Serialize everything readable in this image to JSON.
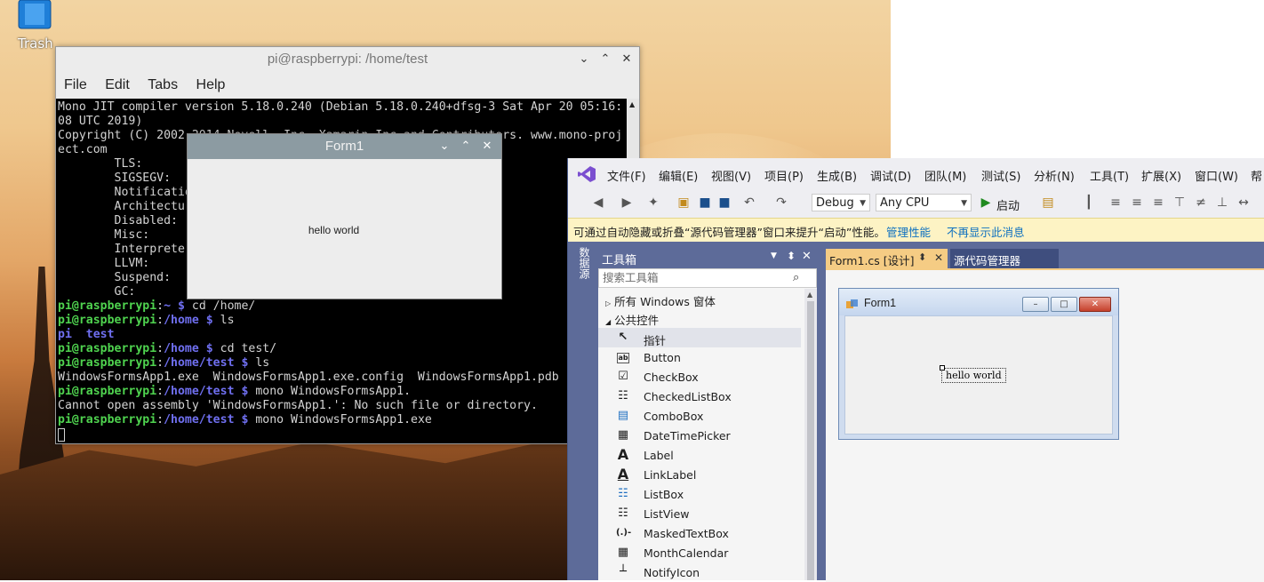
{
  "desktop": {
    "trash_label": "Trash",
    "icons": [
      "trash-icon"
    ]
  },
  "terminal": {
    "title": "pi@raspberrypi: /home/test",
    "menu": [
      "File",
      "Edit",
      "Tabs",
      "Help"
    ],
    "lines": [
      "Mono JIT compiler version 5.18.0.240 (Debian 5.18.0.240+dfsg-3 Sat Apr 20 05:16:",
      "08 UTC 2019)",
      "Copyright (C) 2002-2014 Novell, Inc, Xamarin Inc and Contributors. www.mono-proj",
      "ect.com",
      "        TLS:",
      "        SIGSEGV:",
      "        Notificatio",
      "        Architectur",
      "        Disabled:",
      "        Misc:",
      "        Interprete",
      "        LLVM:",
      "        Suspend:",
      "        GC:"
    ],
    "prompts": [
      {
        "user": "pi@raspberrypi",
        "path": "~",
        "cmd": "cd /home/"
      },
      {
        "user": "pi@raspberrypi",
        "path": "/home",
        "cmd": "ls"
      },
      {
        "output_blue": "pi  test"
      },
      {
        "user": "pi@raspberrypi",
        "path": "/home",
        "cmd": "cd test/"
      },
      {
        "user": "pi@raspberrypi",
        "path": "/home/test",
        "cmd": "ls"
      },
      {
        "output": "WindowsFormsApp1.exe  WindowsFormsApp1.exe.config  WindowsFormsApp1.pdb"
      },
      {
        "user": "pi@raspberrypi",
        "path": "/home/test",
        "cmd": "mono WindowsFormsApp1."
      },
      {
        "output": "Cannot open assembly 'WindowsFormsApp1.': No such file or directory."
      },
      {
        "user": "pi@raspberrypi",
        "path": "/home/test",
        "cmd": "mono WindowsFormsApp1.exe"
      }
    ],
    "colors": {
      "user": "#4fd34f",
      "path": "#6f6ff0",
      "text": "#d3d3d3"
    }
  },
  "form1": {
    "title": "Form1",
    "label": "hello world"
  },
  "vs": {
    "menu": [
      "文件(F)",
      "编辑(E)",
      "视图(V)",
      "项目(P)",
      "生成(B)",
      "调试(D)",
      "团队(M)",
      "测试(S)",
      "分析(N)",
      "工具(T)",
      "扩展(X)",
      "窗口(W)",
      "帮"
    ],
    "toolbar": {
      "config": "Debug",
      "platform": "Any CPU",
      "start": "启动"
    },
    "info_bar": {
      "message": "可通过自动隐藏或折叠“源代码管理器”窗口来提升“启动”性能。",
      "link1": "管理性能",
      "link2": "不再显示此消息"
    },
    "side_tab": "数据源",
    "toolbox": {
      "title": "工具箱",
      "search_placeholder": "搜索工具箱",
      "categories": [
        "所有 Windows 窗体",
        "公共控件"
      ],
      "items": [
        {
          "icon": "pointer-icon",
          "label": "指针"
        },
        {
          "icon": "button-icon",
          "label": "Button"
        },
        {
          "icon": "checkbox-icon",
          "label": "CheckBox"
        },
        {
          "icon": "checkedlistbox-icon",
          "label": "CheckedListBox"
        },
        {
          "icon": "combobox-icon",
          "label": "ComboBox"
        },
        {
          "icon": "datetimepicker-icon",
          "label": "DateTimePicker"
        },
        {
          "icon": "label-icon",
          "label": "Label"
        },
        {
          "icon": "linklabel-icon",
          "label": "LinkLabel"
        },
        {
          "icon": "listbox-icon",
          "label": "ListBox"
        },
        {
          "icon": "listview-icon",
          "label": "ListView"
        },
        {
          "icon": "maskedtextbox-icon",
          "label": "MaskedTextBox"
        },
        {
          "icon": "monthcalendar-icon",
          "label": "MonthCalendar"
        },
        {
          "icon": "notifyicon-icon",
          "label": "NotifyIcon"
        }
      ]
    },
    "tabs": [
      {
        "label": "Form1.cs [设计]",
        "active": true
      },
      {
        "label": "源代码管理器",
        "active": false
      }
    ],
    "designer": {
      "form_title": "Form1",
      "label_text": "hello world"
    },
    "accent": "#f5cc84",
    "chrome": "#5d6b99"
  }
}
